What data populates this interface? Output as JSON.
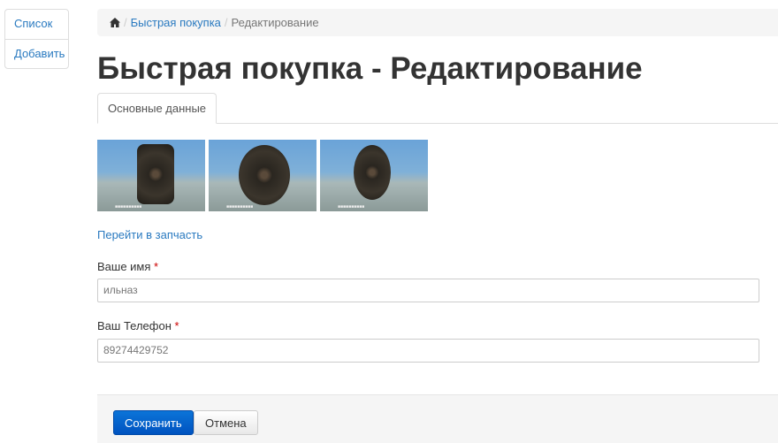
{
  "sidebar": {
    "items": [
      {
        "label": "Список"
      },
      {
        "label": "Добавить"
      }
    ]
  },
  "breadcrumb": {
    "home_icon": "home-icon",
    "items": [
      "Быстрая покупка"
    ],
    "current": "Редактирование"
  },
  "page_title": "Быстрая покупка - Редактирование",
  "tabs": [
    {
      "label": "Основные данные",
      "active": true
    }
  ],
  "photos": [
    "photo-1",
    "photo-2",
    "photo-3"
  ],
  "part_link": "Перейти в запчасть",
  "form": {
    "name": {
      "label": "Ваше имя",
      "required": "*",
      "value": "ильназ"
    },
    "phone": {
      "label": "Ваш Телефон",
      "required": "*",
      "value": "89274429752"
    }
  },
  "actions": {
    "save": "Сохранить",
    "cancel": "Отмена"
  },
  "colors": {
    "link": "#2a7ac0",
    "primary": "#0b63cc"
  }
}
